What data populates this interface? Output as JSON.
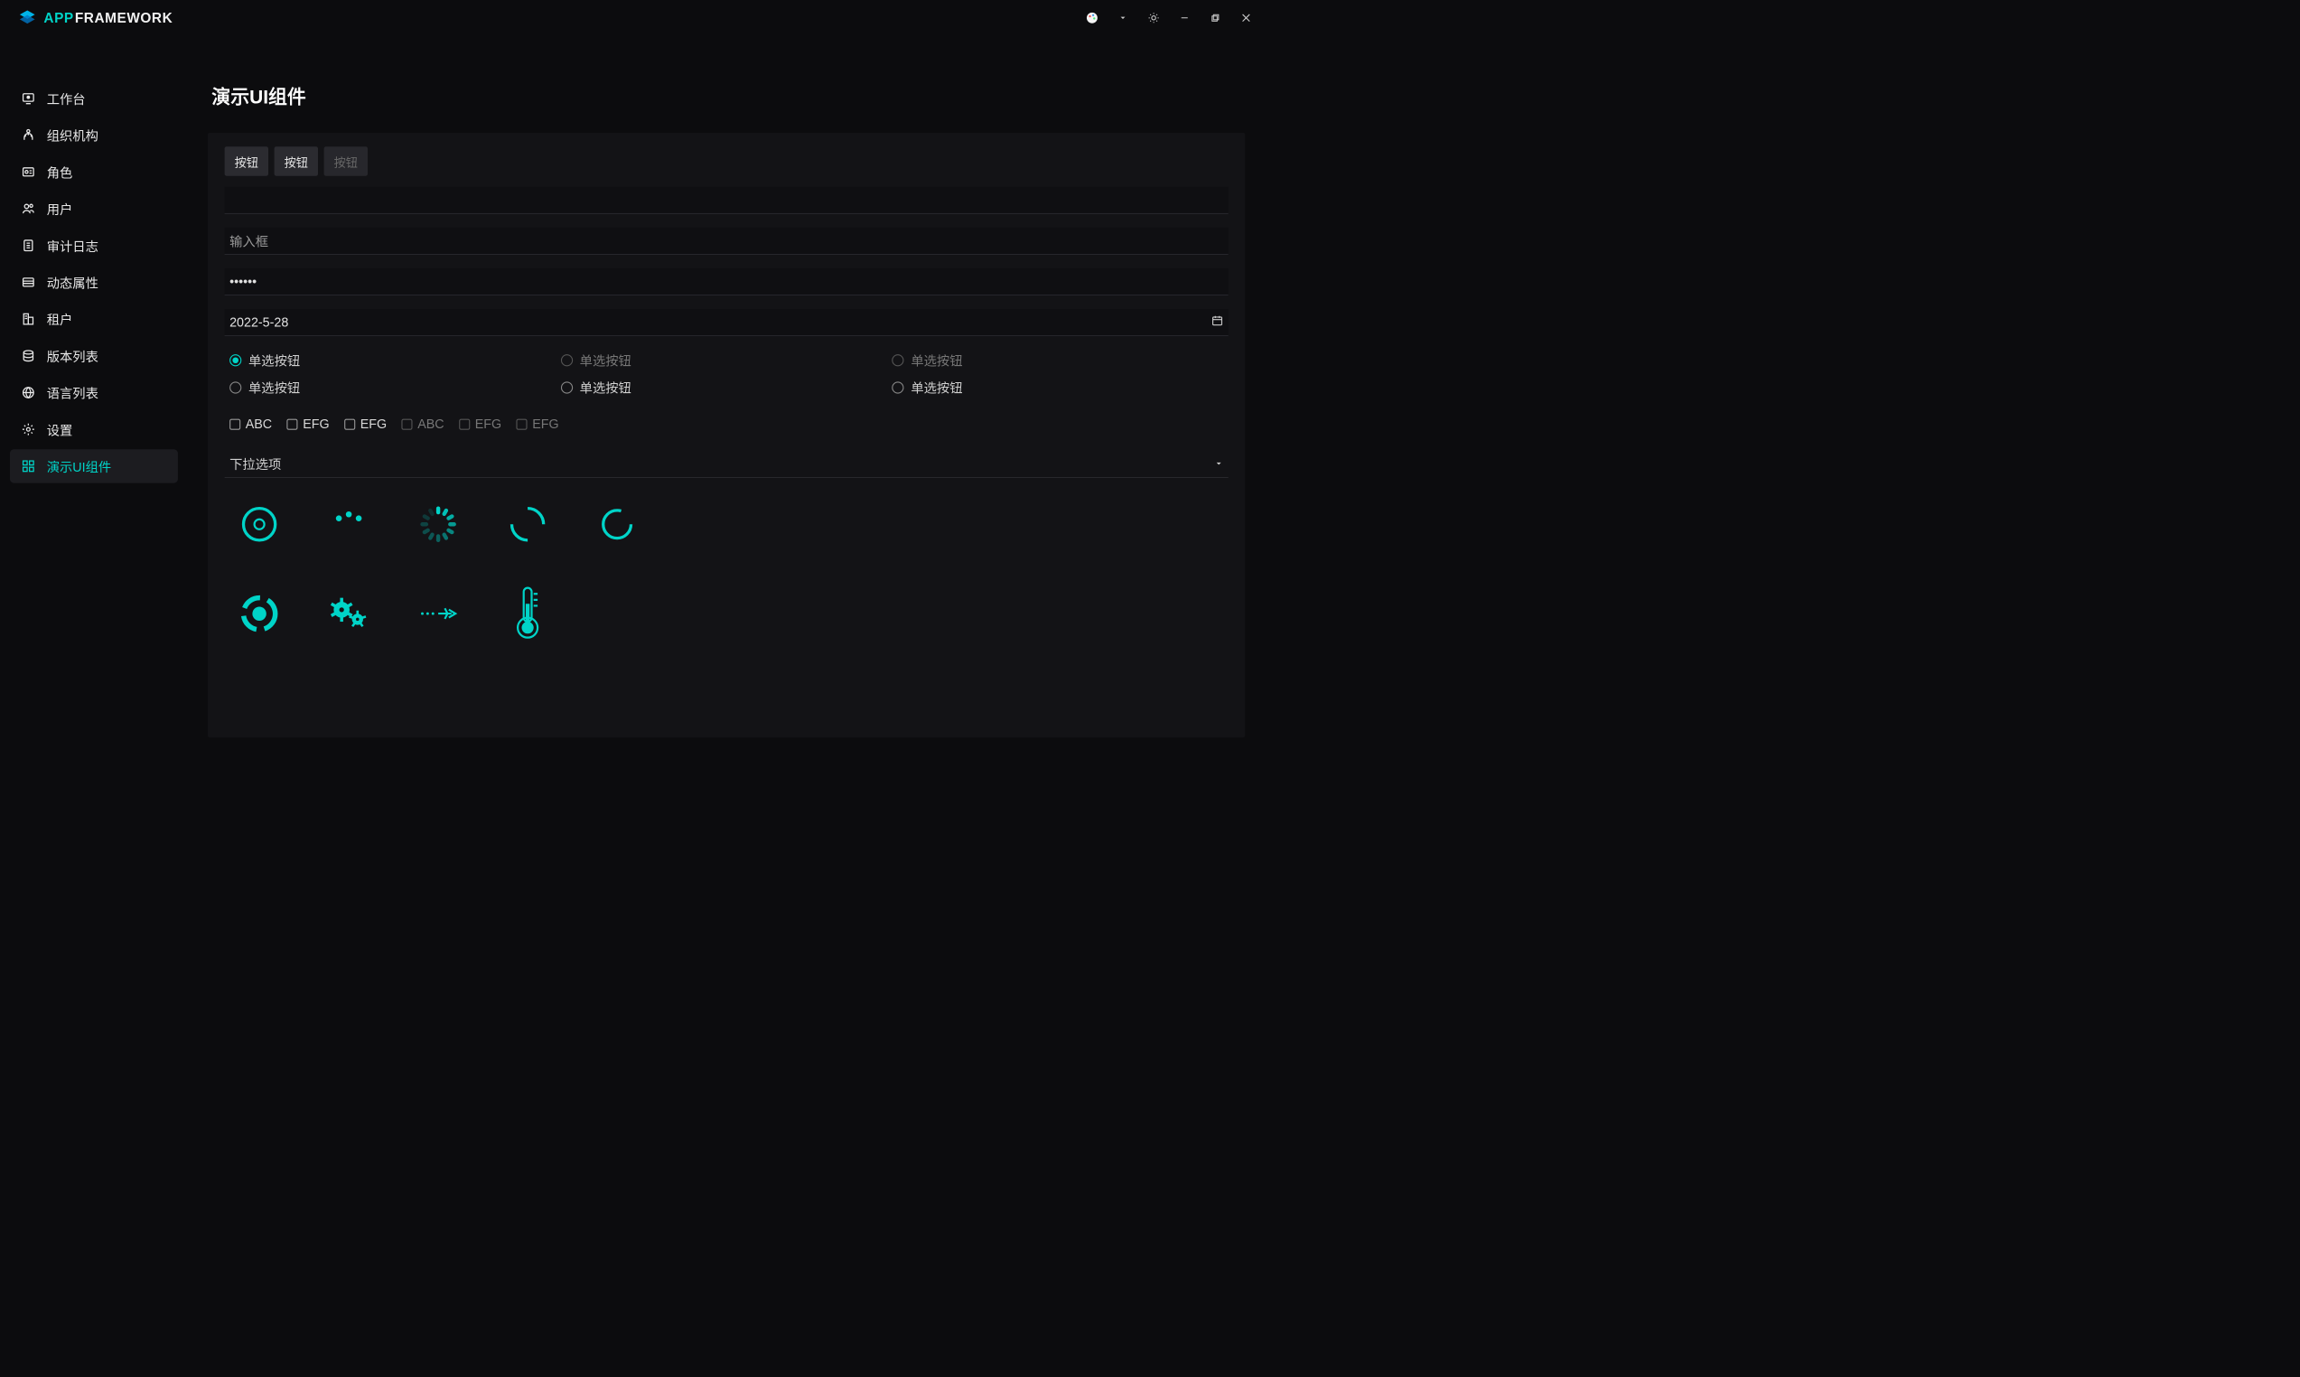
{
  "brand": {
    "accent": "APP",
    "rest": "FRAMEWORK"
  },
  "titlebar": {
    "controls": [
      "theme",
      "dropdown",
      "light",
      "minimize",
      "maximize",
      "close"
    ]
  },
  "sidebar": {
    "items": [
      {
        "name": "workbench",
        "label": "工作台"
      },
      {
        "name": "organization",
        "label": "组织机构"
      },
      {
        "name": "role",
        "label": "角色"
      },
      {
        "name": "user",
        "label": "用户"
      },
      {
        "name": "audit-log",
        "label": "审计日志"
      },
      {
        "name": "dynamic-attr",
        "label": "动态属性"
      },
      {
        "name": "tenant",
        "label": "租户"
      },
      {
        "name": "version-list",
        "label": "版本列表"
      },
      {
        "name": "language-list",
        "label": "语言列表"
      },
      {
        "name": "settings",
        "label": "设置"
      },
      {
        "name": "ui-demo",
        "label": "演示UI组件",
        "active": true
      }
    ]
  },
  "page": {
    "title": "演示UI组件"
  },
  "buttons": [
    {
      "label": "按钮",
      "disabled": false
    },
    {
      "label": "按钮",
      "disabled": false
    },
    {
      "label": "按钮",
      "disabled": true
    }
  ],
  "inputs": {
    "text_empty": "",
    "text_placeholder": "输入框",
    "password_value": "••••••",
    "date_value": "2022-5-28"
  },
  "radios": [
    {
      "label": "单选按钮",
      "selected": true,
      "disabled": false
    },
    {
      "label": "单选按钮",
      "selected": false,
      "disabled": true
    },
    {
      "label": "单选按钮",
      "selected": false,
      "disabled": true
    },
    {
      "label": "单选按钮",
      "selected": false,
      "disabled": false
    },
    {
      "label": "单选按钮",
      "selected": false,
      "disabled": false
    },
    {
      "label": "单选按钮",
      "selected": false,
      "disabled": false
    }
  ],
  "checkboxes": [
    {
      "label": "ABC",
      "disabled": false
    },
    {
      "label": "EFG",
      "disabled": false
    },
    {
      "label": "EFG",
      "disabled": false
    },
    {
      "label": "ABC",
      "disabled": true
    },
    {
      "label": "EFG",
      "disabled": true
    },
    {
      "label": "EFG",
      "disabled": true
    }
  ],
  "dropdown": {
    "label": "下拉选项"
  },
  "spinners": [
    "ring-dot",
    "dots",
    "sunburst",
    "arc",
    "circle-outline",
    "pie-loading",
    "gears",
    "plane-dots",
    "thermometer"
  ],
  "colors": {
    "accent": "#00d4c8",
    "bg": "#0c0c0e",
    "panel": "#131316"
  }
}
